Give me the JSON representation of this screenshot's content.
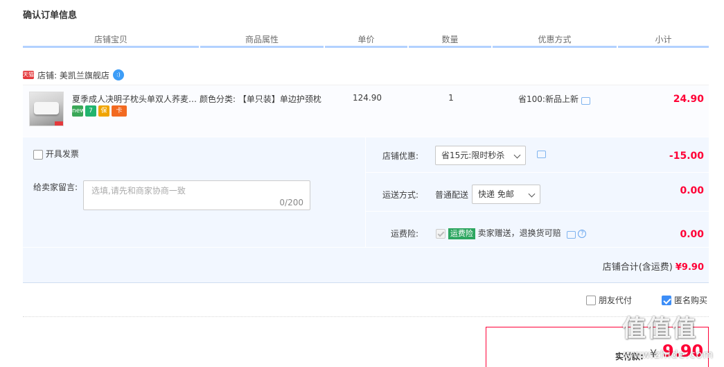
{
  "page": {
    "title": "确认订单信息"
  },
  "table_header": {
    "columns": [
      "店铺宝贝",
      "商品属性",
      "单价",
      "数量",
      "优惠方式",
      "小计"
    ]
  },
  "shop": {
    "mall_badge": "天猫",
    "label": "店铺: 美凯兰旗舰店"
  },
  "item": {
    "name": "夏季成人决明子枕头单双人荞麦…",
    "sku": "颜色分类: 【单只装】单边护颈枕",
    "price": "124.90",
    "quantity": "1",
    "promotion": "省100:新品上新",
    "subtotal": "24.90",
    "badges": [
      "new",
      "7",
      "保",
      "卡"
    ]
  },
  "options": {
    "invoice_label": "开具发票",
    "message_label": "给卖家留言:",
    "message_placeholder": "选填,请先和商家协商一致",
    "message_count": "0/200",
    "shop_discount_label": "店铺优惠:",
    "shop_discount_value": "省15元:限时秒杀",
    "shop_discount_amount": "-15.00",
    "delivery_label": "运送方式:",
    "delivery_type": "普通配送",
    "delivery_value": "快递 免邮",
    "delivery_amount": "0.00",
    "insurance_label": "运费险:",
    "insurance_tag": "运费险",
    "insurance_text": "卖家赠送，退换货可赔",
    "insurance_amount": "0.00",
    "total_label": "店铺合计(含运费)",
    "total_amount": "¥9.90"
  },
  "checkout": {
    "friend_pay_label": "朋友代付",
    "anonymous_label": "匿名购买",
    "paid_label": "实付款:",
    "currency": "¥",
    "paid_amount": "9.90"
  },
  "watermark": {
    "text": "值值值",
    "url": "www.zhide.com"
  },
  "colors": {
    "accent_red": "#ff0036",
    "accent_blue": "#3d8ef7",
    "panel_bg": "#f2f7ff",
    "tag_green": "#2da660"
  }
}
